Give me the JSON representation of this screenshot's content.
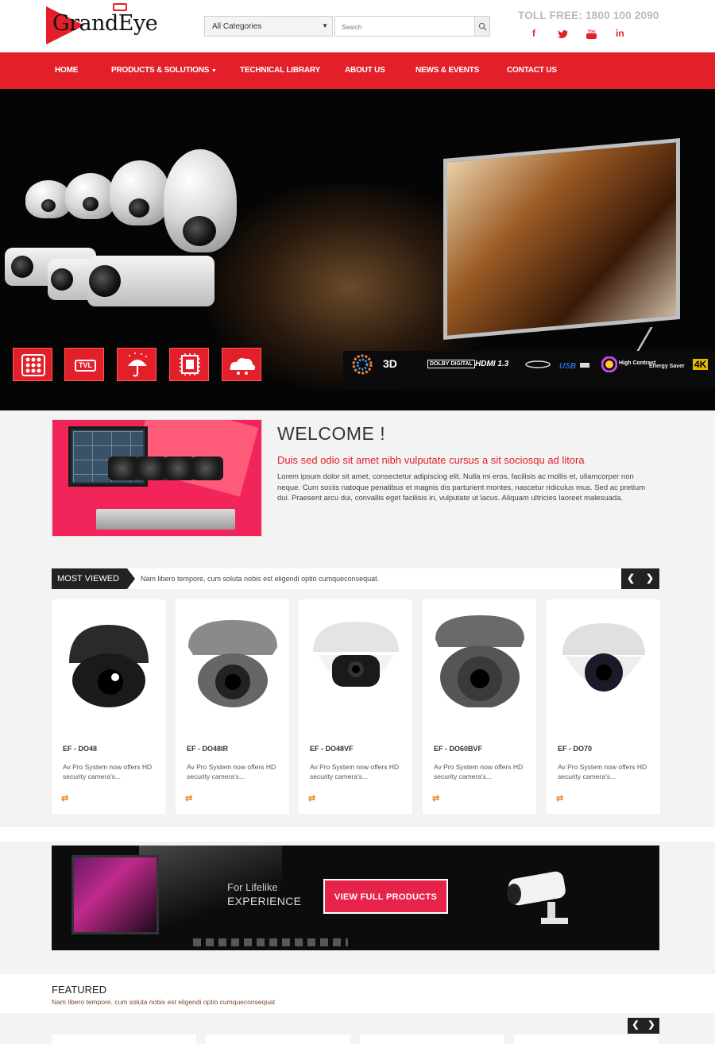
{
  "header": {
    "logo_text": "GrandEye",
    "category_select": "All Categories",
    "search_placeholder": "Search",
    "tollfree": "TOLL FREE: 1800 100 2090",
    "social": [
      {
        "name": "facebook-icon",
        "glyph": "f"
      },
      {
        "name": "twitter-icon",
        "glyph": "t"
      },
      {
        "name": "youtube-icon",
        "glyph": "You Tube"
      },
      {
        "name": "linkedin-icon",
        "glyph": "in"
      }
    ]
  },
  "nav": {
    "items": [
      "HOME",
      "PRODUCTS & SOLUTIONS",
      "TECHNICAL LIBRARY",
      "ABOUT US",
      "NEWS & EVENTS",
      "CONTACT US"
    ]
  },
  "hero": {
    "icon_label": "TVL",
    "features": [
      "3D",
      "DOLBY DIGITAL",
      "HDMI 1.3",
      "High Contrast",
      "Energy Saver",
      "4K"
    ]
  },
  "welcome": {
    "title": "WELCOME !",
    "subtitle": "Duis sed odio sit amet nibh vulputate cursus a sit sociosqu ad litora",
    "body": "Lorem ipsum dolor sit amet, consectetur adipiscing elit. Nulla mi eros, facilisis ac mollis et, ullamcorper non neque. Cum sociis natoque penatibus et magnis dis parturient montes, nascetur ridiculus mus. Sed ac pretium dui. Praesent arcu dui, convallis eget facilisis in, vulputate ut lacus. Aliquam ultricies laoreet malesuada."
  },
  "most_viewed": {
    "label": "MOST VIEWED",
    "text": "Nam libero tempore, cum soluta nobis est eligendi optio cumqueconsequat.",
    "prev": "❮",
    "next": "❯",
    "products": [
      {
        "name": "EF - DO48",
        "desc": "Av Pro System now offers HD security camera's...",
        "dome": "#2a2a2a"
      },
      {
        "name": "EF - DO48IR",
        "desc": "Av Pro System now offers HD security camera's...",
        "dome": "#8a8a8a"
      },
      {
        "name": "EF - DO48VF",
        "desc": "Av Pro System now offers HD security camera's...",
        "dome": "#e8e8e8"
      },
      {
        "name": "EF - DO60BVF",
        "desc": "Av Pro System now offers HD security camera's...",
        "dome": "#6a6a6a"
      },
      {
        "name": "EF - DO70",
        "desc": "Av Pro System now offers HD security camera's...",
        "dome": "#e0e0e0"
      }
    ]
  },
  "banner": {
    "small": "For Lifelike",
    "big": "EXPERIENCE",
    "button": "VIEW FULL PRODUCTS"
  },
  "featured": {
    "title": "FEATURED",
    "subtitle": "Nam libero tempore, cum soluta nobis est eligendi optio cumqueconsequat",
    "prev": "❮",
    "next": "❯"
  },
  "colors": {
    "accent": "#e3202a",
    "dark": "#222222",
    "background": "#f3f3f3"
  }
}
